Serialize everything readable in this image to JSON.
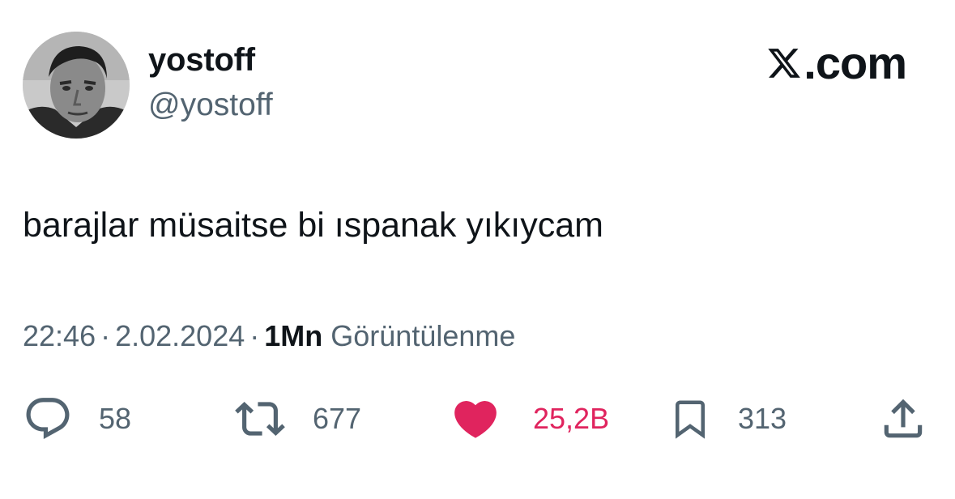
{
  "author": {
    "display_name": "yostoff",
    "handle": "@yostoff"
  },
  "brand": {
    "text": ".com",
    "icon": "x-logo-icon"
  },
  "tweet": {
    "text": "barajlar müsaitse bi ıspanak yıkıycam"
  },
  "meta": {
    "time": "22:46",
    "date": "2.02.2024",
    "separator": "·",
    "views_count": "1Mn",
    "views_label": "Görüntülenme"
  },
  "actions": {
    "replies": "58",
    "retweets": "677",
    "likes": "25,2B",
    "bookmarks": "313"
  },
  "colors": {
    "text_primary": "#0f1419",
    "text_secondary": "#536471",
    "like": "#e0245e"
  }
}
